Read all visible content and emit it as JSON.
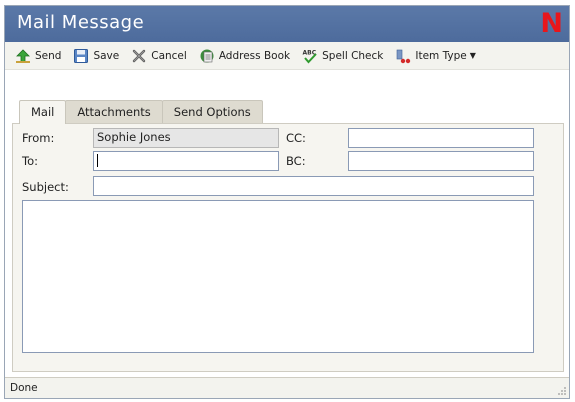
{
  "window": {
    "title": "Mail Message",
    "logo": "N"
  },
  "toolbar": {
    "send": "Send",
    "save": "Save",
    "cancel": "Cancel",
    "address_book": "Address Book",
    "spell_check": "Spell Check",
    "item_type": "Item Type"
  },
  "tabs": [
    "Mail",
    "Attachments",
    "Send Options"
  ],
  "form": {
    "from_label": "From:",
    "from_value": "Sophie Jones",
    "to_label": "To:",
    "to_value": "",
    "cc_label": "CC:",
    "cc_value": "",
    "bc_label": "BC:",
    "bc_value": "",
    "subject_label": "Subject:",
    "subject_value": "",
    "message_body": ""
  },
  "status": {
    "text": "Done"
  },
  "colors": {
    "titlebar": "#5472a4",
    "logo": "#e8161b",
    "panel": "#f6f5f0"
  }
}
